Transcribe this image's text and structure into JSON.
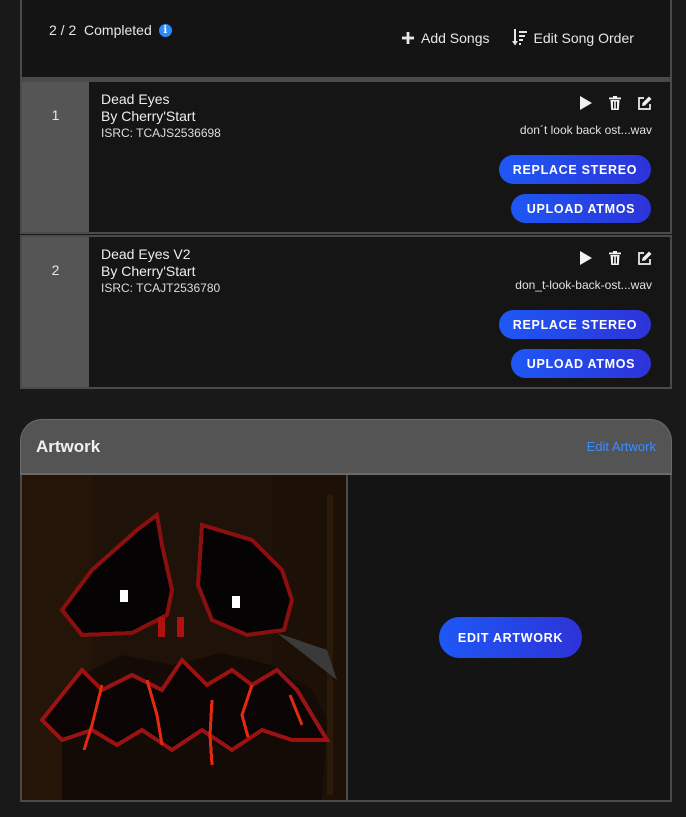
{
  "header": {
    "progress_text": "2 / 2  Completed",
    "info_glyph": "i",
    "add_songs_label": "Add Songs",
    "edit_order_label": "Edit Song Order"
  },
  "songs": [
    {
      "number": "1",
      "title": "Dead Eyes",
      "artist": "By Cherry'Start",
      "isrc": "ISRC: TCAJS2536698",
      "file": "don´t look back ost...wav",
      "replace_label": "REPLACE STEREO",
      "atmos_label": "UPLOAD ATMOS"
    },
    {
      "number": "2",
      "title": "Dead Eyes V2",
      "artist": "By Cherry'Start",
      "isrc": "ISRC: TCAJT2536780",
      "file": "don_t-look-back-ost...wav",
      "replace_label": "REPLACE STEREO",
      "atmos_label": "UPLOAD ATMOS"
    }
  ],
  "artwork": {
    "title": "Artwork",
    "edit_link": "Edit Artwork",
    "edit_button": "EDIT ARTWORK"
  },
  "colors": {
    "background": "#191919",
    "panel": "#151515",
    "border": "#4a4a4a",
    "number_column": "#555555",
    "accent_blue": "#2a8cff",
    "button_gradient_start": "#1e58f5",
    "button_gradient_end": "#2d33d8"
  },
  "icons": {
    "add": "plus-icon",
    "order": "sort-order-icon",
    "play": "play-icon",
    "delete": "trash-icon",
    "edit": "edit-icon",
    "info": "info-icon"
  }
}
